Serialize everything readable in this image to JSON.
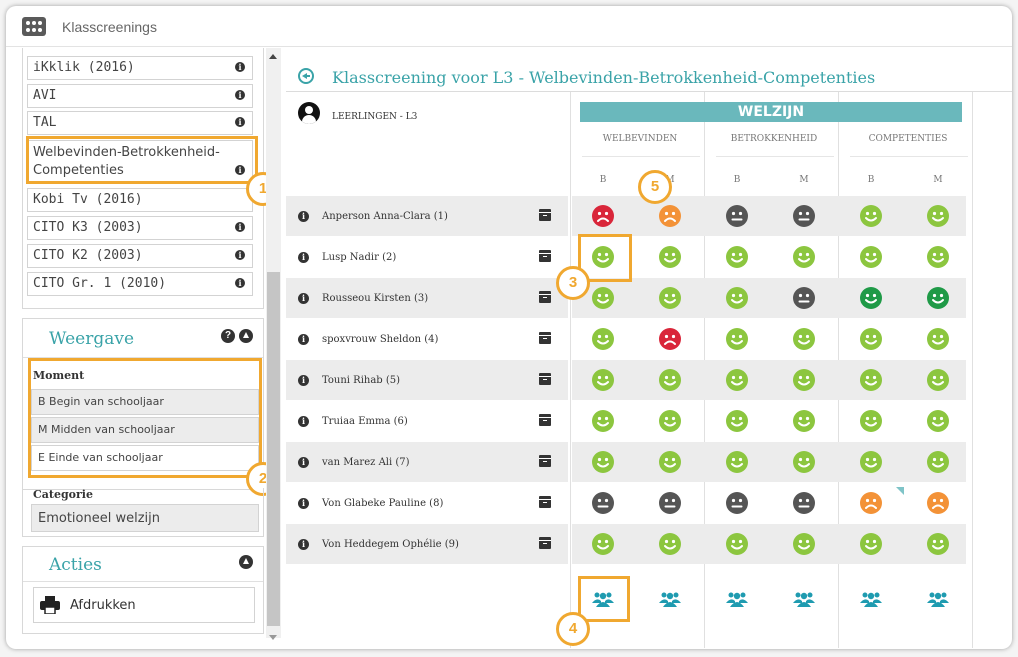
{
  "app": {
    "title": "Klasscreenings"
  },
  "sidebar": {
    "screenings": [
      {
        "label": "iKklik (2016)"
      },
      {
        "label": "AVI"
      },
      {
        "label": "TAL"
      },
      {
        "label": "Welbevinden-Betrokkenheid-\nCompetenties",
        "label_1": "Welbevinden-Betrokkenheid-",
        "label_2": "Competenties"
      },
      {
        "label": "Kobi Tv (2016)"
      },
      {
        "label": "CITO K3 (2003)"
      },
      {
        "label": "CITO K2 (2003)"
      },
      {
        "label": "CITO Gr. 1 (2010)"
      }
    ],
    "weergave": {
      "title": "Weergave",
      "moment_label": "Moment",
      "moments": [
        "B Begin van schooljaar",
        "M Midden van schooljaar",
        "E Einde van schooljaar"
      ],
      "categorie_label": "Categorie",
      "categorie_value": "Emotioneel welzijn"
    },
    "acties": {
      "title": "Acties",
      "print_label": "Afdrukken"
    }
  },
  "main": {
    "title": "Klasscreening voor L3 - Welbevinden-Betrokkenheid-Competenties",
    "students_label": "LEERLINGEN - L3",
    "group": "WELZIJN",
    "categories": [
      "WELBEVINDEN",
      "BETROKKENHEID",
      "COMPETENTIES"
    ],
    "moments": [
      "B",
      "M",
      "B",
      "M",
      "B",
      "M"
    ],
    "students": [
      {
        "name": "Anperson Anna-Clara (1)",
        "scores": [
          "sad-red",
          "sad-orange",
          "neutral-grey",
          "neutral-grey",
          "happy-light",
          "happy-light"
        ]
      },
      {
        "name": "Lusp Nadir (2)",
        "scores": [
          "happy-light",
          "happy-light",
          "happy-light",
          "happy-light",
          "happy-light",
          "happy-light"
        ]
      },
      {
        "name": "Rousseou Kirsten (3)",
        "scores": [
          "happy-light",
          "happy-light",
          "happy-light",
          "neutral-grey",
          "happy-dark",
          "happy-dark"
        ]
      },
      {
        "name": "spoxvrouw Sheldon (4)",
        "scores": [
          "happy-light",
          "sad-red",
          "happy-light",
          "happy-light",
          "happy-light",
          "happy-light"
        ]
      },
      {
        "name": "Touni Rihab (5)",
        "scores": [
          "happy-light",
          "happy-light",
          "happy-light",
          "happy-light",
          "happy-light",
          "happy-light"
        ]
      },
      {
        "name": "Truiaa Emma (6)",
        "scores": [
          "happy-light",
          "happy-light",
          "happy-light",
          "happy-light",
          "happy-light",
          "happy-light"
        ]
      },
      {
        "name": "van Marez Ali (7)",
        "scores": [
          "happy-light",
          "happy-light",
          "happy-light",
          "happy-light",
          "happy-light",
          "happy-light"
        ]
      },
      {
        "name": "Von Glabeke Pauline (8)",
        "scores": [
          "neutral-grey",
          "neutral-grey",
          "neutral-grey",
          "neutral-grey",
          "sad-orange",
          "sad-orange"
        ]
      },
      {
        "name": "Von Heddegem Ophélie (9)",
        "scores": [
          "happy-light",
          "happy-light",
          "happy-light",
          "happy-light",
          "happy-light",
          "happy-light"
        ]
      }
    ]
  },
  "callouts": [
    "1",
    "2",
    "3",
    "4",
    "5"
  ],
  "colors": {
    "accent": "#3aa3a8",
    "highlight": "#f0a830",
    "happy-light": "#8cc63f",
    "happy-dark": "#1f9a47",
    "sad-red": "#d9263a",
    "sad-orange": "#f39237",
    "neutral-grey": "#555555",
    "group-icon": "#1f9bb0"
  }
}
